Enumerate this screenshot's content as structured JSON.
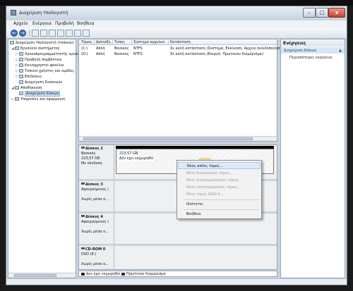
{
  "window": {
    "title": "Διαχείριση Υπολογιστή",
    "btn_min": "–",
    "btn_max": "□",
    "btn_close": "x"
  },
  "menubar": [
    "Αρχείο",
    "Ενέργεια",
    "Προβολή",
    "Βοήθεια"
  ],
  "toolbar": {
    "back": "←",
    "forward": "→"
  },
  "tree": {
    "root": "Διαχείριση Υπολογιστή (τοπικού)",
    "system_tools": "Εργαλεία συστήματος",
    "items": [
      "Χρονοπρογραμματιστής εργασιών",
      "Προβολή συμβάντων",
      "Κοινόχρηστοι φάκελοι",
      "Τοπικοί χρήστες και ομάδες",
      "Επιδόσεις",
      "Διαχείριση Συσκευών"
    ],
    "storage": "Αποθήκευση",
    "disk_mgmt": "Διαχείριση δίσκων",
    "services": "Υπηρεσίες και εφαρμογές"
  },
  "volumes": {
    "headers": [
      "Τόμος",
      "Διάταξη",
      "Τύπος",
      "Σύστημα αρχείων",
      "Κατάσταση"
    ],
    "rows": [
      {
        "volume": "(C:)",
        "layout": "Απλή",
        "type": "Βασικός",
        "fs": "NTFS",
        "status": "Σε καλή κατάσταση (Σύστημα, Εκκίνηση, Αρχείο σελιδοποίησης..."
      },
      {
        "volume": "(D:)",
        "layout": "Απλή",
        "type": "Βασικός",
        "fs": "NTFS",
        "status": "Σε καλή κατάσταση (Ενεργό, Πρωτεύον διαμέρισμα)"
      }
    ]
  },
  "disks": [
    {
      "name": "Δίσκος 2",
      "type": "Βασικός",
      "size": "223,57 GB",
      "status": "Με σύνδεση",
      "part_size": "223,57 GB",
      "part_status": "Δεν έχει εκχωρηθεί"
    },
    {
      "name": "Δίσκος 3",
      "type": "Αφαιρούμενος (",
      "status": "Χωρίς μέσα α..."
    },
    {
      "name": "Δίσκος 4",
      "type": "Αφαιρούμενος (",
      "status": "Χωρίς μέσα α..."
    },
    {
      "name": "CD-ROM 0",
      "type": "DVD (E:)",
      "status": "Χωρίς μέσα α..."
    }
  ],
  "legend": [
    {
      "label": "Δεν έχει εκχωρηθεί",
      "color": "#000000"
    },
    {
      "label": "Πρωτεύον διαμέρισμα",
      "color": "#1c2b6e"
    }
  ],
  "actions": {
    "title": "Ενέργειες",
    "section": "Διαχείριση δίσκων",
    "more": "Περισσότερες ενέργειες"
  },
  "context_menu": {
    "items": [
      {
        "label": "Νέος απλός τόμος...",
        "state": "active"
      },
      {
        "label": "Νέος διαιρεμένος τόμος...",
        "state": "disabled"
      },
      {
        "label": "Νέος διαγραμμισμένος τόμος...",
        "state": "disabled"
      },
      {
        "label": "Νέος κατοπτρισμένος τόμος...",
        "state": "disabled"
      },
      {
        "label": "Νέος τόμος RAID-5...",
        "state": "disabled"
      },
      {
        "label": "Ιδιότητες",
        "state": "enabled"
      },
      {
        "label": "Βοήθεια",
        "state": "enabled"
      }
    ]
  }
}
